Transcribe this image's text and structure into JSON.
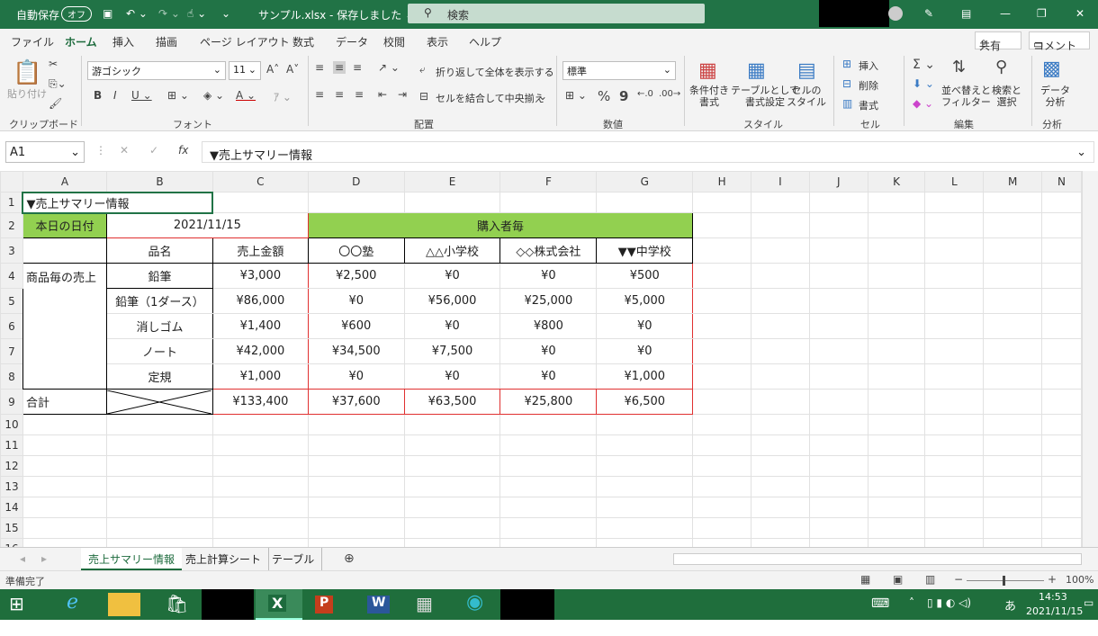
{
  "titlebar": {
    "autosave_label": "自動保存",
    "autosave_state": "オフ",
    "filename": "サンプル.xlsx - 保存しました ⌄",
    "search_placeholder": "検索"
  },
  "ribbon_tabs": [
    "ファイル",
    "ホーム",
    "挿入",
    "描画",
    "ページ レイアウト",
    "数式",
    "データ",
    "校閲",
    "表示",
    "ヘルプ"
  ],
  "share_label": "共有",
  "comment_label": "コメント",
  "ribbon": {
    "paste": "貼り付け",
    "clipboard": "クリップボード",
    "font_name": "游ゴシック",
    "font_size": "11",
    "font_group": "フォント",
    "wrap_text": "折り返して全体を表示する",
    "merge_center": "セルを結合して中央揃え",
    "align_group": "配置",
    "number_format": "標準",
    "number_group": "数値",
    "cond_format": "条件付き\n書式",
    "table_format": "テーブルとして\n書式設定",
    "cell_style": "セルの\nスタイル",
    "style_group": "スタイル",
    "insert": "挿入",
    "delete": "削除",
    "format": "書式",
    "cell_group": "セル",
    "sort_filter": "並べ替えと\nフィルター",
    "find_select": "検索と\n選択",
    "edit_group": "編集",
    "data_analysis": "データ\n分析",
    "analysis_group": "分析"
  },
  "formula_bar": {
    "name_box": "A1",
    "fx": "fx",
    "formula": "▼売上サマリー情報"
  },
  "columns": [
    "A",
    "B",
    "C",
    "D",
    "E",
    "F",
    "G",
    "H",
    "I",
    "J",
    "K",
    "L",
    "M",
    "N"
  ],
  "rows": [
    "1",
    "2",
    "3",
    "4",
    "5",
    "6",
    "7",
    "8",
    "9",
    "10",
    "11",
    "12",
    "13",
    "14",
    "15",
    "16"
  ],
  "cells": {
    "a1": "▼売上サマリー情報",
    "a2": "本日の日付",
    "b2": "2021/11/15",
    "d2": "購入者毎",
    "b3": "品名",
    "c3": "売上金額",
    "d3": "〇〇塾",
    "e3": "△△小学校",
    "f3": "◇◇株式会社",
    "g3": "▼▼中学校",
    "a4": "商品毎の売上",
    "a9": "合計",
    "items": [
      {
        "name": "鉛筆",
        "c": "¥3,000",
        "d": "¥2,500",
        "e": "¥0",
        "f": "¥0",
        "g": "¥500"
      },
      {
        "name": "鉛筆（1ダース）",
        "c": "¥86,000",
        "d": "¥0",
        "e": "¥56,000",
        "f": "¥25,000",
        "g": "¥5,000"
      },
      {
        "name": "消しゴム",
        "c": "¥1,400",
        "d": "¥600",
        "e": "¥0",
        "f": "¥800",
        "g": "¥0"
      },
      {
        "name": "ノート",
        "c": "¥42,000",
        "d": "¥34,500",
        "e": "¥7,500",
        "f": "¥0",
        "g": "¥0"
      },
      {
        "name": "定規",
        "c": "¥1,000",
        "d": "¥0",
        "e": "¥0",
        "f": "¥0",
        "g": "¥1,000"
      }
    ],
    "totals": {
      "c": "¥133,400",
      "d": "¥37,600",
      "e": "¥63,500",
      "f": "¥25,800",
      "g": "¥6,500"
    }
  },
  "sheet_tabs": [
    "売上サマリー情報",
    "売上計算シート",
    "テーブル"
  ],
  "status": {
    "ready": "準備完了",
    "zoom": "100%"
  },
  "taskbar": {
    "time": "14:53",
    "date": "2021/11/15",
    "ime": "あ"
  },
  "colors": {
    "excel_green": "#217346",
    "header_fill": "#92d050",
    "border_red": "#e03030"
  }
}
